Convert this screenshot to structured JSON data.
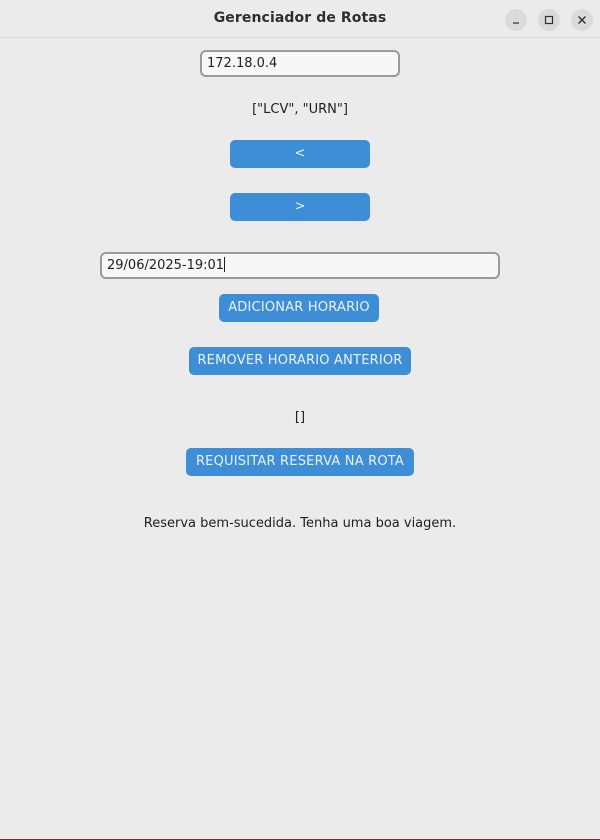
{
  "window": {
    "title": "Gerenciador de Rotas"
  },
  "icons": {
    "minimize": "minimize-icon",
    "maximize": "maximize-icon",
    "close": "close-icon"
  },
  "server": {
    "ip_value": "172.18.0.4"
  },
  "routes": {
    "list_text": "[\"LCV\", \"URN\"]",
    "prev_label": "<",
    "next_label": ">"
  },
  "schedule": {
    "datetime_value": "29/06/2025-19:01",
    "add_label": "ADICIONAR HORARIO",
    "remove_label": "REMOVER HORARIO ANTERIOR",
    "list_text": "[]"
  },
  "reservation": {
    "request_label": "REQUISITAR RESERVA NA ROTA",
    "status_message": "Reserva bem-sucedida. Tenha uma boa viagem."
  },
  "colors": {
    "button_bg": "#3d8ed6",
    "button_text": "#eaf2fb",
    "window_bg": "#ebebeb"
  }
}
